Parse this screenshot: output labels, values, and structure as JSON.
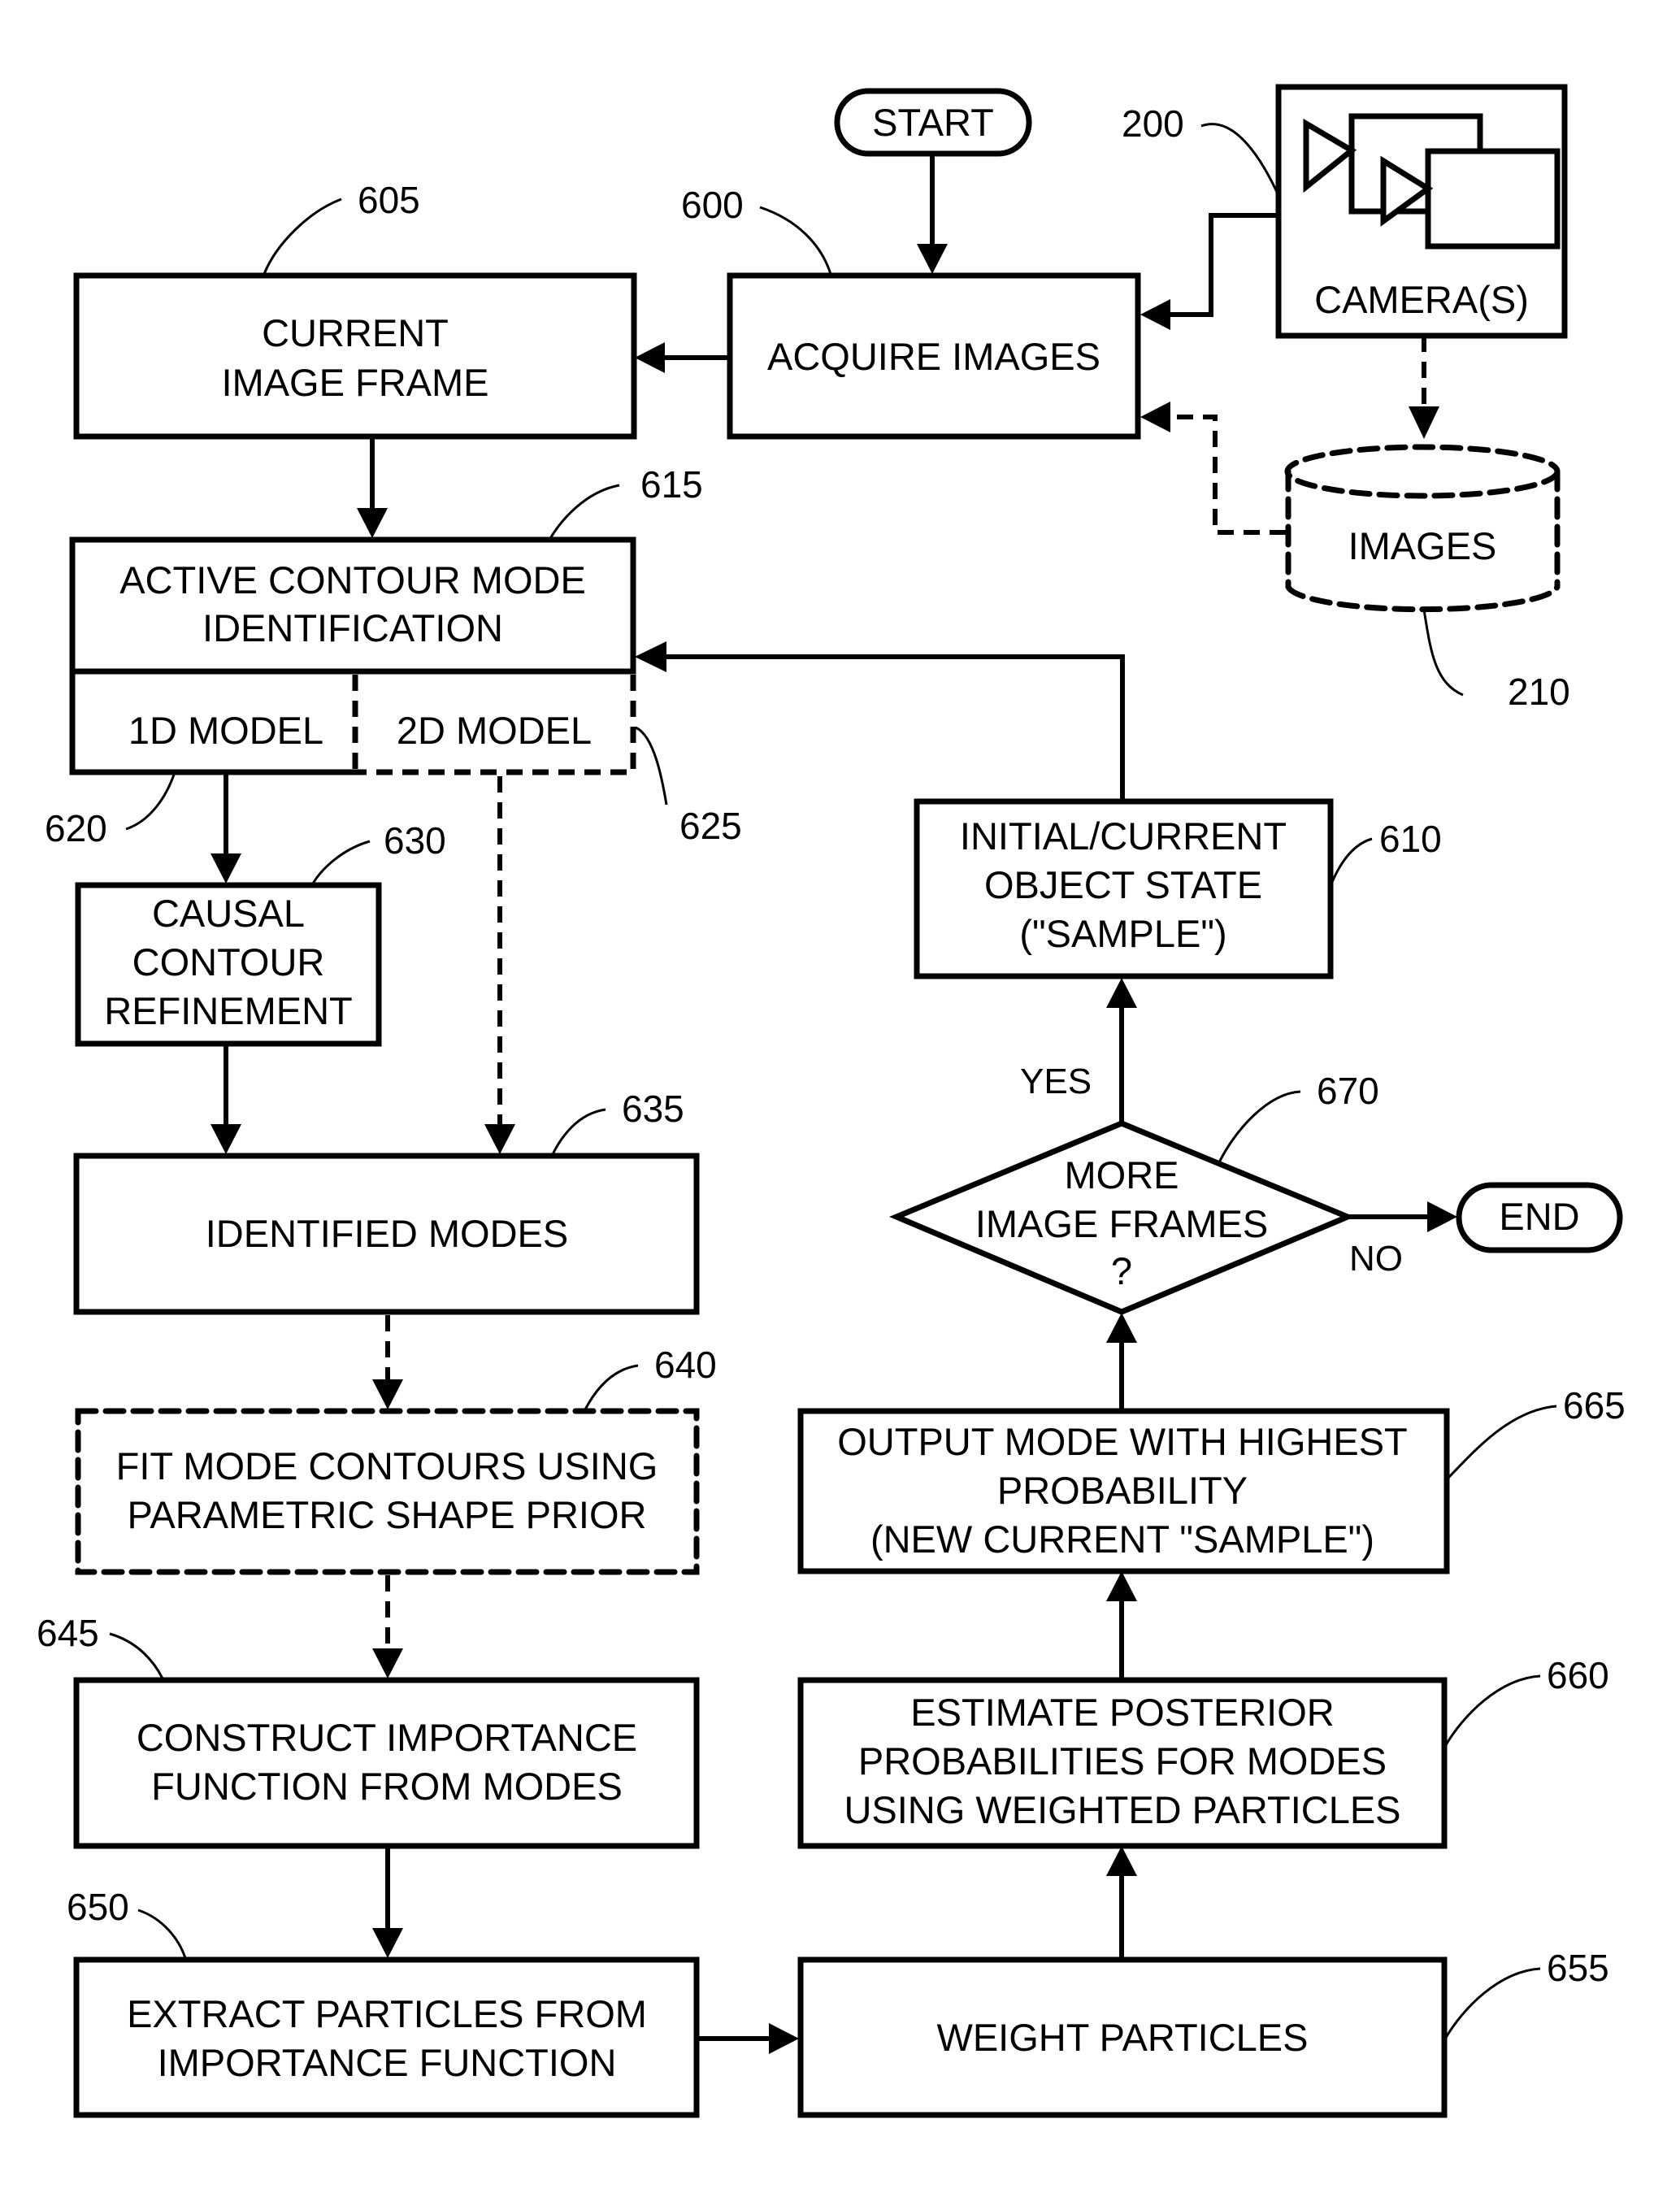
{
  "figure": {
    "type": "patent flowchart",
    "nodes": {
      "start": {
        "label": [
          "START"
        ]
      },
      "end": {
        "label": [
          "END"
        ]
      },
      "camera": {
        "label": [
          "CAMERA(S)"
        ],
        "ref": "200"
      },
      "images_db": {
        "label": [
          "IMAGES"
        ],
        "ref": "210"
      },
      "acquire": {
        "label": [
          "ACQUIRE IMAGES"
        ],
        "ref": "600"
      },
      "current_frame": {
        "label": [
          "CURRENT",
          "IMAGE FRAME"
        ],
        "ref": "605"
      },
      "object_state": {
        "label": [
          "INITIAL/CURRENT",
          "OBJECT STATE",
          "(\"SAMPLE\")"
        ],
        "ref": "610"
      },
      "active_contour": {
        "label": [
          "ACTIVE CONTOUR MODE",
          "IDENTIFICATION"
        ],
        "ref": "615"
      },
      "model_1d": {
        "label": [
          "1D MODEL"
        ],
        "ref": "620"
      },
      "model_2d": {
        "label": [
          "2D MODEL"
        ],
        "ref": "625"
      },
      "causal": {
        "label": [
          "CAUSAL",
          "CONTOUR",
          "REFINEMENT"
        ],
        "ref": "630"
      },
      "identified": {
        "label": [
          "IDENTIFIED MODES"
        ],
        "ref": "635"
      },
      "fit": {
        "label": [
          "FIT MODE CONTOURS USING",
          "PARAMETRIC SHAPE PRIOR"
        ],
        "ref": "640"
      },
      "construct": {
        "label": [
          "CONSTRUCT IMPORTANCE",
          "FUNCTION FROM MODES"
        ],
        "ref": "645"
      },
      "extract": {
        "label": [
          "EXTRACT PARTICLES FROM",
          "IMPORTANCE FUNCTION"
        ],
        "ref": "650"
      },
      "weight": {
        "label": [
          "WEIGHT PARTICLES"
        ],
        "ref": "655"
      },
      "estimate": {
        "label": [
          "ESTIMATE POSTERIOR",
          "PROBABILITIES FOR MODES",
          "USING WEIGHTED PARTICLES"
        ],
        "ref": "660"
      },
      "output": {
        "label": [
          "OUTPUT  MODE WITH HIGHEST",
          "PROBABILITY",
          "(NEW CURRENT \"SAMPLE\")"
        ],
        "ref": "665"
      },
      "decision": {
        "label": [
          "MORE",
          "IMAGE FRAMES",
          "?"
        ],
        "ref": "670"
      }
    },
    "edge_labels": {
      "yes": "YES",
      "no": "NO"
    }
  }
}
